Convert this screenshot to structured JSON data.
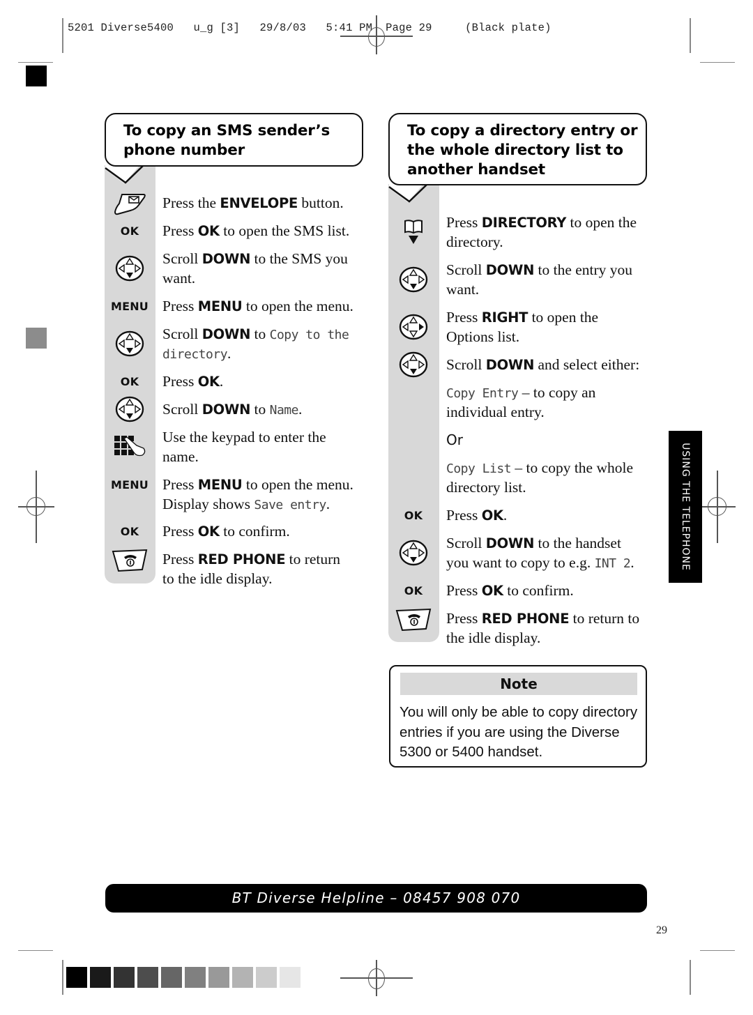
{
  "print_slug": "5201 Diverse5400   u_g [3]   29/8/03   5:41 PM  Page 29     (Black plate)",
  "left_section": {
    "title_line1": "To copy an SMS sender’s",
    "title_line2": "phone number",
    "steps": [
      {
        "icon": "envelope-button-icon",
        "key_label": "",
        "parts": [
          [
            "t",
            "Press the "
          ],
          [
            "b",
            "ENVELOPE"
          ],
          [
            "t",
            " button."
          ]
        ]
      },
      {
        "icon": "ok-key",
        "key_label": "OK",
        "parts": [
          [
            "t",
            "Press "
          ],
          [
            "b",
            "OK"
          ],
          [
            "t",
            " to open the SMS list."
          ]
        ]
      },
      {
        "icon": "nav-down-icon",
        "key_label": "",
        "parts": [
          [
            "t",
            "Scroll "
          ],
          [
            "b",
            "DOWN"
          ],
          [
            "t",
            " to the SMS you"
          ]
        ],
        "line2": [
          [
            "t",
            "want."
          ]
        ]
      },
      {
        "icon": "menu-key",
        "key_label": "MENU",
        "parts": [
          [
            "t",
            "Press "
          ],
          [
            "b",
            "MENU"
          ],
          [
            "t",
            " to open the menu."
          ]
        ]
      },
      {
        "icon": "nav-down-icon",
        "key_label": "",
        "parts": [
          [
            "t",
            "Scroll "
          ],
          [
            "b",
            "DOWN"
          ],
          [
            "t",
            " to "
          ],
          [
            "l",
            "Copy to the"
          ]
        ],
        "line2": [
          [
            "l",
            "directory"
          ],
          [
            "t",
            "."
          ]
        ]
      },
      {
        "icon": "ok-key",
        "key_label": "OK",
        "parts": [
          [
            "t",
            "Press "
          ],
          [
            "b",
            "OK"
          ],
          [
            "t",
            "."
          ]
        ]
      },
      {
        "icon": "nav-down-icon",
        "key_label": "",
        "parts": [
          [
            "t",
            "Scroll "
          ],
          [
            "b",
            "DOWN"
          ],
          [
            "t",
            " to "
          ],
          [
            "l",
            "Name"
          ],
          [
            "t",
            "."
          ]
        ]
      },
      {
        "icon": "keypad-icon",
        "key_label": "",
        "parts": [
          [
            "t",
            "Use the keypad to enter the"
          ]
        ],
        "line2": [
          [
            "t",
            "name."
          ]
        ]
      },
      {
        "icon": "menu-key",
        "key_label": "MENU",
        "parts": [
          [
            "t",
            "Press "
          ],
          [
            "b",
            "MENU"
          ],
          [
            "t",
            " to open the menu."
          ]
        ],
        "line2": [
          [
            "t",
            "Display shows "
          ],
          [
            "l",
            "Save entry"
          ],
          [
            "t",
            "."
          ]
        ]
      },
      {
        "icon": "ok-key",
        "key_label": "OK",
        "parts": [
          [
            "t",
            "Press "
          ],
          [
            "b",
            "OK"
          ],
          [
            "t",
            " to confirm."
          ]
        ]
      },
      {
        "icon": "red-phone-icon",
        "key_label": "",
        "parts": [
          [
            "t",
            "Press "
          ],
          [
            "b",
            "RED PHONE"
          ],
          [
            "t",
            " to return"
          ]
        ],
        "line2": [
          [
            "t",
            "to the idle display."
          ]
        ]
      }
    ]
  },
  "right_section": {
    "title_line1": "To copy a directory entry or",
    "title_line2": "the whole directory list to",
    "title_line3": "another handset",
    "steps": [
      {
        "icon": "directory-book-icon",
        "key_label": "",
        "parts": [
          [
            "t",
            "Press "
          ],
          [
            "b",
            "DIRECTORY"
          ],
          [
            "t",
            " to open the"
          ]
        ],
        "line2": [
          [
            "t",
            "directory."
          ]
        ]
      },
      {
        "icon": "nav-down-icon",
        "key_label": "",
        "parts": [
          [
            "t",
            "Scroll "
          ],
          [
            "b",
            "DOWN"
          ],
          [
            "t",
            " to the entry you"
          ]
        ],
        "line2": [
          [
            "t",
            "want."
          ]
        ]
      },
      {
        "icon": "nav-right-icon",
        "key_label": "",
        "parts": [
          [
            "t",
            "Press "
          ],
          [
            "b",
            "RIGHT"
          ],
          [
            "t",
            " to open the"
          ]
        ],
        "line2": [
          [
            "t",
            "Options list."
          ]
        ]
      },
      {
        "icon": "nav-down-icon",
        "key_label": "",
        "parts": [
          [
            "t",
            "Scroll "
          ],
          [
            "b",
            "DOWN"
          ],
          [
            "t",
            " and select either:"
          ]
        ]
      },
      {
        "icon": "",
        "key_label": "",
        "parts": [
          [
            "l",
            "Copy Entry"
          ],
          [
            "t",
            " – to copy an"
          ]
        ],
        "line2": [
          [
            "t",
            "individual entry."
          ]
        ]
      },
      {
        "icon": "",
        "key_label": "",
        "parts": [
          [
            "o",
            "Or"
          ]
        ]
      },
      {
        "icon": "",
        "key_label": "",
        "parts": [
          [
            "l",
            "Copy List"
          ],
          [
            "t",
            " – to copy the whole"
          ]
        ],
        "line2": [
          [
            "t",
            "directory list."
          ]
        ]
      },
      {
        "icon": "ok-key",
        "key_label": "OK",
        "parts": [
          [
            "t",
            "Press "
          ],
          [
            "b",
            "OK"
          ],
          [
            "t",
            "."
          ]
        ]
      },
      {
        "icon": "nav-down-icon",
        "key_label": "",
        "parts": [
          [
            "t",
            "Scroll "
          ],
          [
            "b",
            "DOWN"
          ],
          [
            "t",
            " to the handset"
          ]
        ],
        "line2": [
          [
            "t",
            "you want to copy to e.g. "
          ],
          [
            "l",
            "INT 2"
          ],
          [
            "t",
            "."
          ]
        ]
      },
      {
        "icon": "ok-key",
        "key_label": "OK",
        "parts": [
          [
            "t",
            "Press "
          ],
          [
            "b",
            "OK"
          ],
          [
            "t",
            " to confirm."
          ]
        ]
      },
      {
        "icon": "red-phone-icon",
        "key_label": "",
        "parts": [
          [
            "t",
            "Press "
          ],
          [
            "b",
            "RED PHONE"
          ],
          [
            "t",
            " to return to"
          ]
        ],
        "line2": [
          [
            "t",
            "the idle display."
          ]
        ]
      }
    ]
  },
  "note": {
    "heading": "Note",
    "body": "You will only be able to copy directory\nentries if you are using the Diverse\n5300 or 5400 handset."
  },
  "side_tab": "USING THE TELEPHONE",
  "helpline": "BT Diverse Helpline – 08457 908 070",
  "page_number": "29",
  "swatches": [
    "#000000",
    "#1a1a1a",
    "#333333",
    "#4d4d4d",
    "#666666",
    "#808080",
    "#999999",
    "#b3b3b3",
    "#cccccc",
    "#e6e6e6"
  ]
}
